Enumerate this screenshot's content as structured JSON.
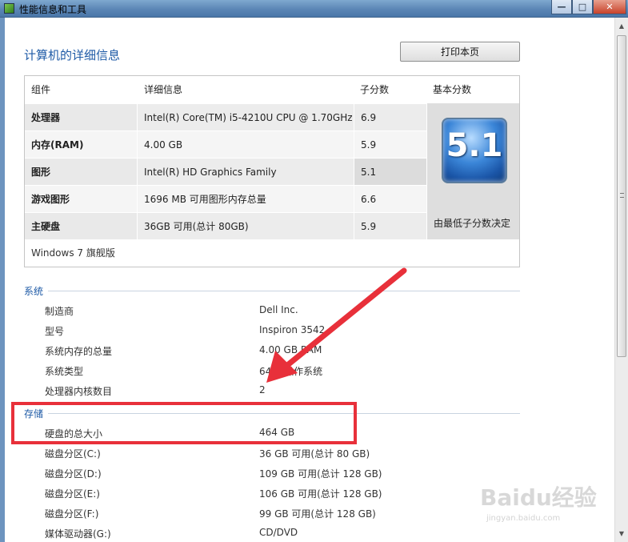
{
  "window": {
    "title": "性能信息和工具",
    "buttons": {
      "minimize": "—",
      "maximize": "□",
      "close": "✕"
    }
  },
  "page": {
    "heading": "计算机的详细信息",
    "print_button": "打印本页"
  },
  "score_table": {
    "headers": {
      "component": "组件",
      "details": "详细信息",
      "subscore": "子分数",
      "base": "基本分数"
    },
    "rows": [
      {
        "component": "处理器",
        "details": "Intel(R) Core(TM) i5-4210U CPU @ 1.70GHz",
        "subscore": "6.9"
      },
      {
        "component": "内存(RAM)",
        "details": "4.00 GB",
        "subscore": "5.9"
      },
      {
        "component": "图形",
        "details": "Intel(R) HD Graphics Family",
        "subscore": "5.1"
      },
      {
        "component": "游戏图形",
        "details": "1696 MB 可用图形内存总量",
        "subscore": "6.6"
      },
      {
        "component": "主硬盘",
        "details": "36GB 可用(总计 80GB)",
        "subscore": "5.9"
      }
    ],
    "base_score": "5.1",
    "base_caption": "由最低子分数决定",
    "os": "Windows 7 旗舰版"
  },
  "system": {
    "title": "系统",
    "rows": [
      {
        "k": "制造商",
        "v": "Dell Inc."
      },
      {
        "k": "型号",
        "v": "Inspiron 3542"
      },
      {
        "k": "系统内存的总量",
        "v": "4.00 GB RAM"
      },
      {
        "k": "系统类型",
        "v": "64 位操作系统"
      },
      {
        "k": "处理器内核数目",
        "v": "2"
      }
    ]
  },
  "storage": {
    "title": "存储",
    "rows": [
      {
        "k": "硬盘的总大小",
        "v": "464 GB"
      },
      {
        "k": "磁盘分区(C:)",
        "v": "36 GB 可用(总计 80 GB)"
      },
      {
        "k": "磁盘分区(D:)",
        "v": "109 GB 可用(总计 128 GB)"
      },
      {
        "k": "磁盘分区(E:)",
        "v": "106 GB 可用(总计 128 GB)"
      },
      {
        "k": "磁盘分区(F:)",
        "v": "99 GB 可用(总计 128 GB)"
      },
      {
        "k": "媒体驱动器(G:)",
        "v": "CD/DVD"
      }
    ]
  },
  "watermark": {
    "logo": "Baidu经验",
    "url": "jingyan.baidu.com"
  },
  "colors": {
    "accent": "#1e5aa6",
    "annotation": "#e8303a"
  }
}
